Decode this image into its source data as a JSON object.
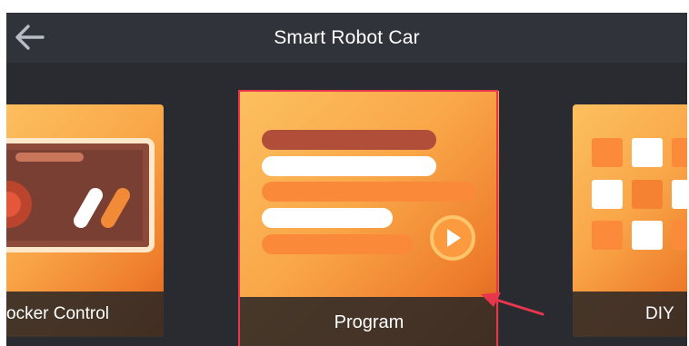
{
  "header": {
    "title": "Smart Robot Car",
    "back_icon": "arrow-left-icon"
  },
  "cards": {
    "rocker": {
      "label": "ocker Control",
      "icon": "rocker-control-illustration"
    },
    "program": {
      "label": "Program",
      "icon": "program-illustration",
      "selected": true
    },
    "diy": {
      "label": "DIY Co",
      "icon": "diy-grid-illustration"
    }
  },
  "colors": {
    "background": "#2a2b30",
    "header": "#303339",
    "card_orange": "#f9a648",
    "selection_border": "#e8364d",
    "annotation_arrow": "#e8364d"
  }
}
